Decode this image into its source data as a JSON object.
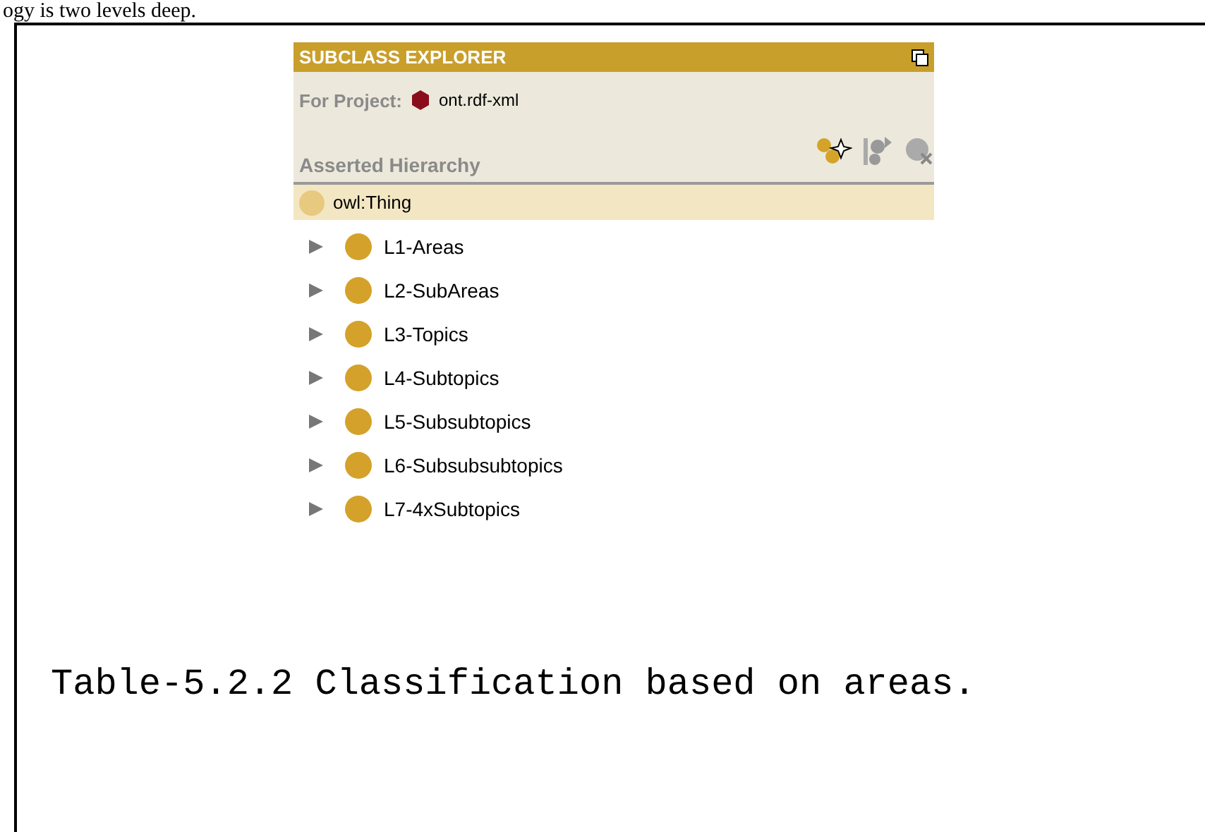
{
  "page_text_above": "ogy is two levels deep.",
  "panel": {
    "title": "SUBCLASS EXPLORER",
    "project_label": "For Project:",
    "project_name": "ont.rdf-xml",
    "hierarchy_label": "Asserted Hierarchy"
  },
  "root": {
    "label": "owl:Thing",
    "selected": true
  },
  "classes": [
    {
      "label": "L1-Areas",
      "expanded": false,
      "selected": false
    },
    {
      "label": "L2-SubAreas",
      "expanded": false,
      "selected": false
    },
    {
      "label": "L3-Topics",
      "expanded": false,
      "selected": false
    },
    {
      "label": "L4-Subtopics",
      "expanded": false,
      "selected": false
    },
    {
      "label": "L5-Subsubtopics",
      "expanded": false,
      "selected": false
    },
    {
      "label": "L6-Subsubsubtopics",
      "expanded": false,
      "selected": false
    },
    {
      "label": "L7-4xSubtopics",
      "expanded": false,
      "selected": false
    }
  ],
  "caption": "Table-5.2.2 Classification based on areas."
}
